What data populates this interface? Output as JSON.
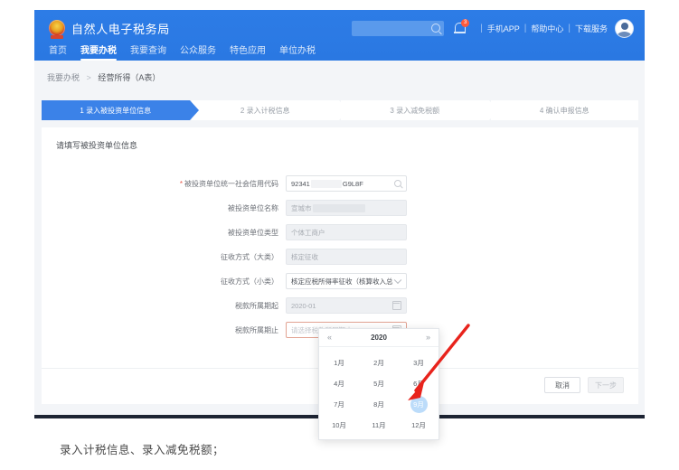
{
  "header": {
    "brand_title": "自然人电子税务局",
    "logo_icon": "emblem-icon",
    "search_placeholder": "",
    "search_icon": "search-icon",
    "bell_icon": "bell-icon",
    "bell_badge": "3",
    "links": [
      {
        "label": "手机APP"
      },
      {
        "label": "帮助中心"
      },
      {
        "label": "下载服务"
      }
    ],
    "separator": "|",
    "avatar_icon": "user-avatar"
  },
  "nav": {
    "items": [
      {
        "label": "首页",
        "active": false
      },
      {
        "label": "我要办税",
        "active": true
      },
      {
        "label": "我要查询",
        "active": false
      },
      {
        "label": "公众服务",
        "active": false
      },
      {
        "label": "特色应用",
        "active": false
      },
      {
        "label": "单位办税",
        "active": false
      }
    ]
  },
  "breadcrumb": {
    "root": "我要办税",
    "separator": ">",
    "current": "经营所得（A表）"
  },
  "steps": [
    {
      "label": "1 录入被投资单位信息",
      "active": true
    },
    {
      "label": "2 录入计税信息",
      "active": false
    },
    {
      "label": "3 录入减免税额",
      "active": false
    },
    {
      "label": "4 确认申报信息",
      "active": false
    }
  ],
  "card": {
    "title": "请填写被投资单位信息",
    "fields": [
      {
        "label": "被投资单位统一社会信用代码",
        "required": true,
        "value_prefix": "92341",
        "value_suffix": "G9L8F",
        "masked": true,
        "disabled": false,
        "icon": "search-icon"
      },
      {
        "label": "被投资单位名称",
        "required": false,
        "value_prefix": "宣城市",
        "value_suffix": "",
        "masked": true,
        "disabled": true,
        "icon": ""
      },
      {
        "label": "被投资单位类型",
        "required": false,
        "value_prefix": "个体工商户",
        "value_suffix": "",
        "masked": false,
        "disabled": true,
        "icon": ""
      },
      {
        "label": "征收方式（大类）",
        "required": false,
        "value_prefix": "核定征收",
        "value_suffix": "",
        "masked": false,
        "disabled": true,
        "icon": ""
      },
      {
        "label": "征收方式（小类）",
        "required": false,
        "value_prefix": "核定应税所得率征收（核算收入总额）",
        "value_suffix": "",
        "masked": false,
        "disabled": false,
        "icon": "chevron-down-icon"
      },
      {
        "label": "税款所属期起",
        "required": false,
        "value_prefix": "2020-01",
        "value_suffix": "",
        "masked": false,
        "disabled": true,
        "icon": "calendar-icon"
      },
      {
        "label": "税款所属期止",
        "required": false,
        "value_prefix": "",
        "value_suffix": "",
        "placeholder": "请选择税款所属期止",
        "masked": false,
        "disabled": false,
        "error": true,
        "icon": "calendar-icon"
      }
    ]
  },
  "datepicker": {
    "prev_icon": "«",
    "next_icon": "»",
    "year": "2020",
    "months": [
      "1月",
      "2月",
      "3月",
      "4月",
      "5月",
      "6月",
      "7月",
      "8月",
      "9月",
      "10月",
      "11月",
      "12月"
    ],
    "selected": "9月",
    "selected_color": "#bcdcfa"
  },
  "footer": {
    "cancel_label": "取消",
    "next_label": "下一步",
    "next_disabled": true
  },
  "annotation": {
    "arrow_color": "#e8231c",
    "arrow_name": "red-pointer-arrow"
  },
  "caption": "录入计税信息、录入减免税额；",
  "colors": {
    "header_blue": "#2a7ae4",
    "step_active": "#3b82e8",
    "page_bg": "#f3f5f8",
    "dark_bar": "#1d2433",
    "required_star": "#e8584a"
  }
}
